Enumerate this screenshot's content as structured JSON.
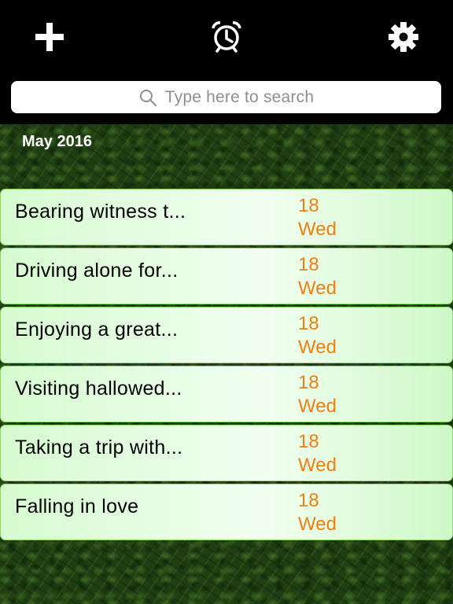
{
  "toolbar": {
    "add_icon": "plus-icon",
    "alarm_icon": "alarm-clock-icon",
    "settings_icon": "gear-icon"
  },
  "search": {
    "placeholder": "Type here to search",
    "icon": "search-icon"
  },
  "month": "May 2016",
  "colors": {
    "accent_date": "#f07f14",
    "entry_border": "#8fdc6c",
    "background": "#1f3f12"
  },
  "entries": [
    {
      "title": "Bearing witness t...",
      "day": "18",
      "weekday": "Wed"
    },
    {
      "title": "Driving alone for...",
      "day": "18",
      "weekday": "Wed"
    },
    {
      "title": "Enjoying a great...",
      "day": "18",
      "weekday": "Wed"
    },
    {
      "title": "Visiting hallowed...",
      "day": "18",
      "weekday": "Wed"
    },
    {
      "title": "Taking a trip with...",
      "day": "18",
      "weekday": "Wed"
    },
    {
      "title": "Falling in love",
      "day": "18",
      "weekday": "Wed"
    }
  ]
}
